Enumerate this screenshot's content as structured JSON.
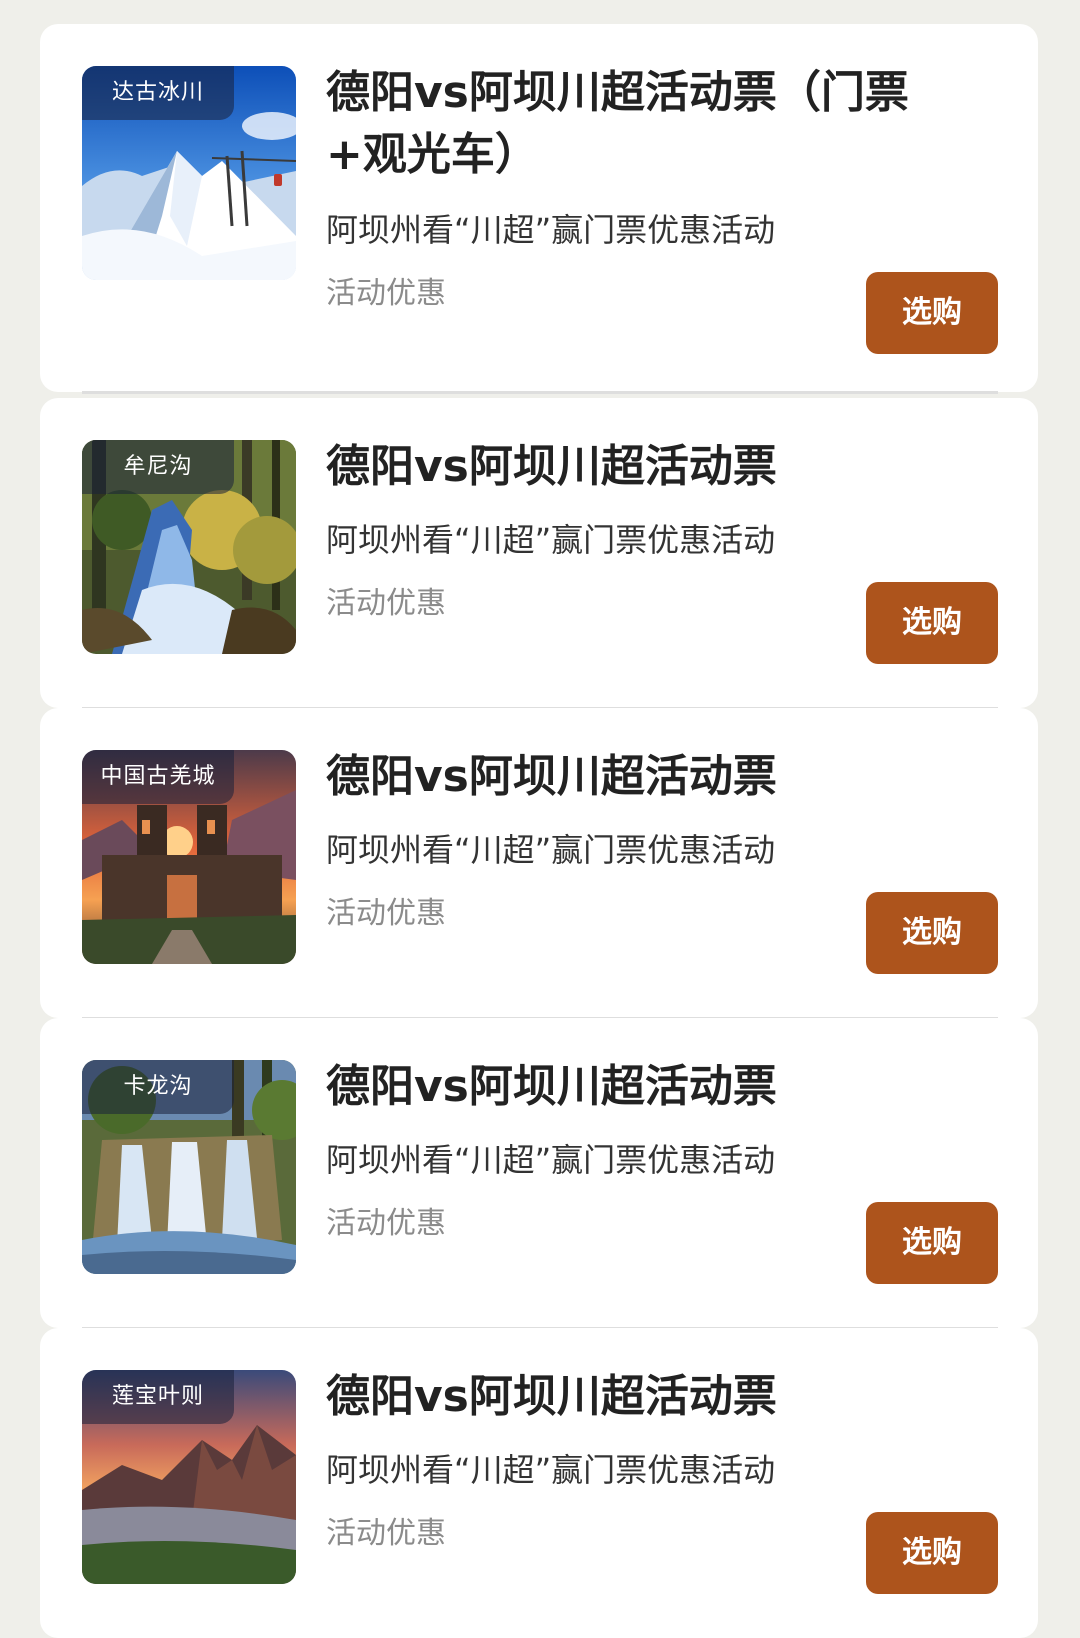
{
  "colors": {
    "background": "#efefea",
    "card": "#ffffff",
    "button": "#ad541c",
    "title": "#222222",
    "tag": "#8b8b8b"
  },
  "items": [
    {
      "image_label": "达古冰川",
      "image_theme": "glacier-mountain",
      "title": "德阳vs阿坝川超活动票（门票+观光车）",
      "subtitle": "阿坝州看“川超”赢门票优惠活动",
      "tag": "活动优惠",
      "button_label": "选购"
    },
    {
      "image_label": "牟尼沟",
      "image_theme": "forest-waterfall",
      "title": "德阳vs阿坝川超活动票",
      "subtitle": "阿坝州看“川超”赢门票优惠活动",
      "tag": "活动优惠",
      "button_label": "选购"
    },
    {
      "image_label": "中国古羌城",
      "image_theme": "castle-sunset",
      "title": "德阳vs阿坝川超活动票",
      "subtitle": "阿坝州看“川超”赢门票优惠活动",
      "tag": "活动优惠",
      "button_label": "选购"
    },
    {
      "image_label": "卡龙沟",
      "image_theme": "waterfall",
      "title": "德阳vs阿坝川超活动票",
      "subtitle": "阿坝州看“川超”赢门票优惠活动",
      "tag": "活动优惠",
      "button_label": "选购"
    },
    {
      "image_label": "莲宝叶则",
      "image_theme": "mountain-sunset",
      "title": "德阳vs阿坝川超活动票",
      "subtitle": "阿坝州看“川超”赢门票优惠活动",
      "tag": "活动优惠",
      "button_label": "选购"
    }
  ]
}
